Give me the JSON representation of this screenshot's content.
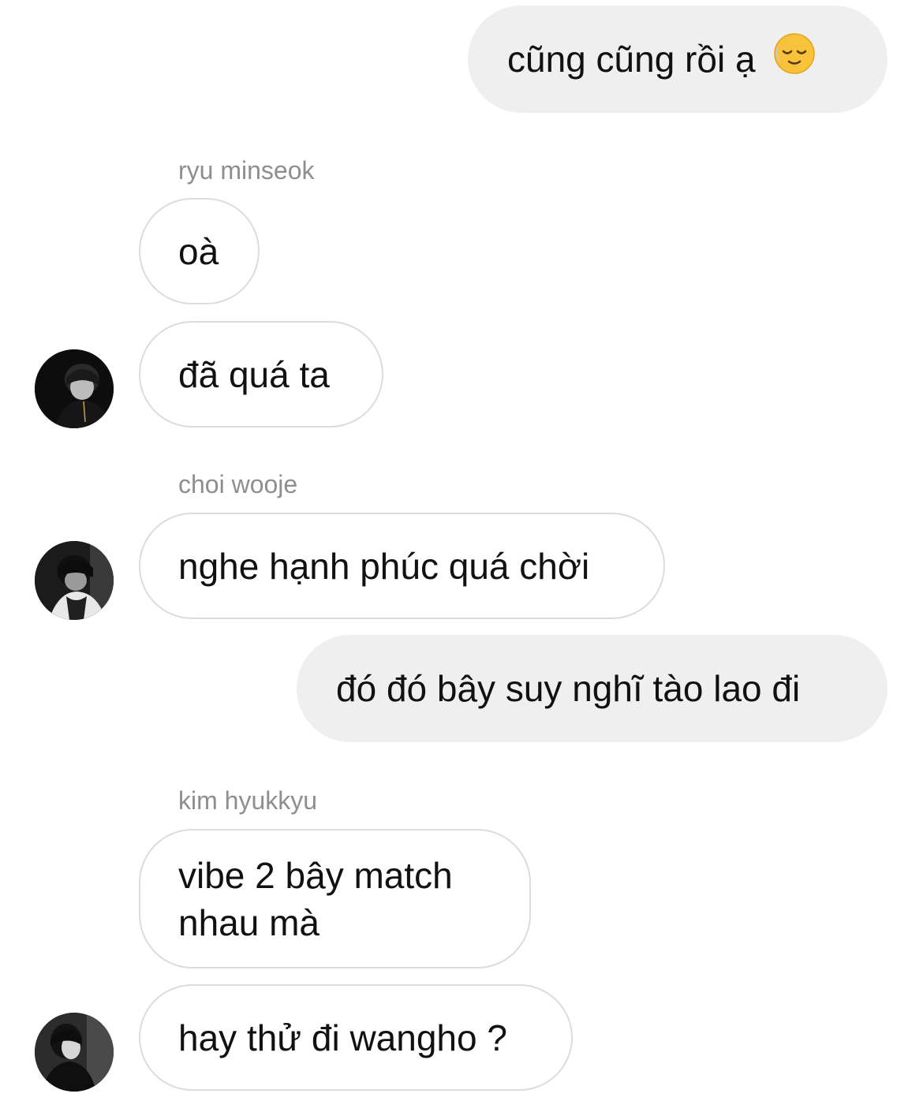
{
  "messages": [
    {
      "direction": "outgoing",
      "text": "cũng cũng rồi ạ",
      "emoji": "relieved-face-emoji"
    },
    {
      "direction": "incoming",
      "sender": "ryu minseok",
      "text": "oà"
    },
    {
      "direction": "incoming",
      "text": "đã quá ta"
    },
    {
      "direction": "incoming",
      "sender": "choi wooje",
      "text": "nghe hạnh phúc quá chời"
    },
    {
      "direction": "outgoing",
      "text": "đó đó bây suy nghĩ tào lao đi"
    },
    {
      "direction": "incoming",
      "sender": "kim hyukkyu",
      "text_line1": "vibe 2 bây match",
      "text_line2": "nhau mà"
    },
    {
      "direction": "incoming",
      "text": "hay thử đi wangho ?"
    }
  ],
  "colors": {
    "outgoing_bubble": "#efefef",
    "incoming_border": "#dcdcdc",
    "sender_name": "#8e8e8e",
    "text": "#111111"
  },
  "icons": {
    "emoji": "relieved-face-emoji",
    "avatar": "profile-photo"
  }
}
